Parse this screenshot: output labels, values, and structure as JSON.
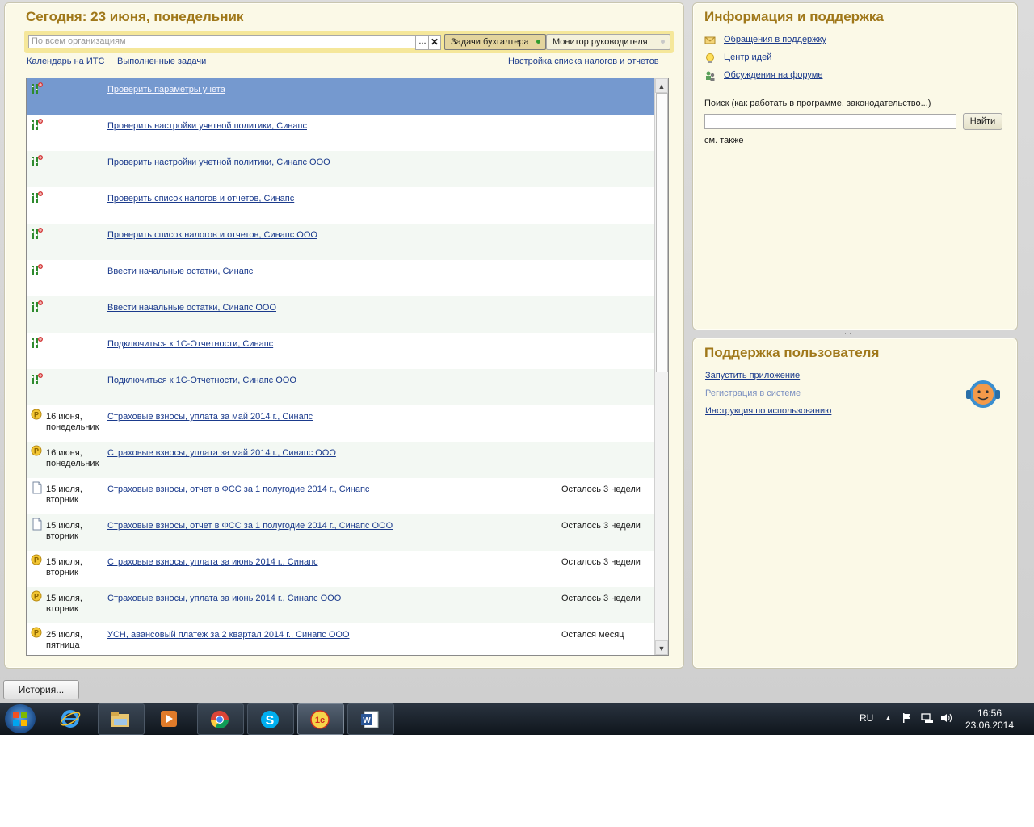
{
  "left_panel": {
    "title": "Сегодня: 23 июня, понедельник",
    "search_placeholder": "По всем организациям",
    "dots": "...",
    "clear": "✕",
    "tab_active": "Задачи бухгалтера",
    "tab_inactive": "Монитор руководителя",
    "link_calendar": "Календарь на ИТС",
    "link_done": "Выполненные задачи",
    "link_settings": "Настройка списка налогов и отчетов"
  },
  "tasks": [
    {
      "icon": "checklist-icon",
      "date": "",
      "name": "Проверить параметры учета",
      "remain": "",
      "selected": true
    },
    {
      "icon": "checklist-icon",
      "date": "",
      "name": "Проверить настройки учетной политики, Синапс",
      "remain": ""
    },
    {
      "icon": "checklist-icon",
      "date": "",
      "name": "Проверить настройки учетной политики, Синапс ООО",
      "remain": ""
    },
    {
      "icon": "checklist-icon",
      "date": "",
      "name": "Проверить список налогов и отчетов, Синапс",
      "remain": ""
    },
    {
      "icon": "checklist-icon",
      "date": "",
      "name": "Проверить список налогов и отчетов, Синапс ООО",
      "remain": ""
    },
    {
      "icon": "checklist-icon",
      "date": "",
      "name": "Ввести начальные остатки, Синапс",
      "remain": ""
    },
    {
      "icon": "checklist-icon",
      "date": "",
      "name": "Ввести начальные остатки, Синапс ООО",
      "remain": ""
    },
    {
      "icon": "checklist-icon",
      "date": "",
      "name": "Подключиться к 1С-Отчетности, Синапс",
      "remain": ""
    },
    {
      "icon": "checklist-icon",
      "date": "",
      "name": "Подключиться к 1С-Отчетности, Синапс ООО",
      "remain": ""
    },
    {
      "icon": "ruble-coin-icon",
      "date": "16 июня, понедельник",
      "name": "Страховые взносы, уплата за май 2014 г., Синапс",
      "remain": ""
    },
    {
      "icon": "ruble-coin-icon",
      "date": "16 июня, понедельник",
      "name": "Страховые взносы, уплата за май 2014 г., Синапс ООО",
      "remain": ""
    },
    {
      "icon": "document-icon",
      "date": "15 июля, вторник",
      "name": "Страховые взносы, отчет в ФСС за 1 полугодие 2014 г., Синапс",
      "remain": "Осталось 3 недели"
    },
    {
      "icon": "document-icon",
      "date": "15 июля, вторник",
      "name": "Страховые взносы, отчет в ФСС за 1 полугодие 2014 г., Синапс ООО",
      "remain": "Осталось 3 недели"
    },
    {
      "icon": "ruble-coin-icon",
      "date": "15 июля, вторник",
      "name": "Страховые взносы, уплата за июнь 2014 г., Синапс",
      "remain": "Осталось 3 недели"
    },
    {
      "icon": "ruble-coin-icon",
      "date": "15 июля, вторник",
      "name": "Страховые взносы, уплата за июнь 2014 г., Синапс ООО",
      "remain": "Осталось 3 недели"
    },
    {
      "icon": "ruble-coin-icon",
      "date": "25 июля, пятница",
      "name": "УСН, авансовый платеж за 2 квартал 2014 г., Синапс ООО",
      "remain": "Остался месяц"
    }
  ],
  "info_panel": {
    "title": "Информация и поддержка",
    "items": [
      {
        "icon": "envelope-icon",
        "label": "Обращения в поддержку"
      },
      {
        "icon": "lightbulb-icon",
        "label": "Центр идей"
      },
      {
        "icon": "forum-users-icon",
        "label": "Обсуждения на форуме"
      }
    ],
    "search_hint": "Поиск (как работать в программе, законодательство...)",
    "find_button": "Найти",
    "see_also": "см. также"
  },
  "support_panel": {
    "title": "Поддержка пользователя",
    "links": [
      {
        "label": "Запустить приложение",
        "dim": false
      },
      {
        "label": "Регистрация в системе",
        "dim": true
      },
      {
        "label": "Инструкция по использованию",
        "dim": false
      }
    ]
  },
  "history_button": "История...",
  "taskbar": {
    "apps": [
      "internet-explorer-icon",
      "file-explorer-icon",
      "media-player-icon",
      "chrome-icon",
      "skype-icon",
      "1c-icon",
      "word-icon"
    ],
    "lang": "RU",
    "time": "16:56",
    "date": "23.06.2014"
  },
  "colors": {
    "title": "#a0781a",
    "selected_row": "#7599cf",
    "link": "#1a3a8c"
  }
}
